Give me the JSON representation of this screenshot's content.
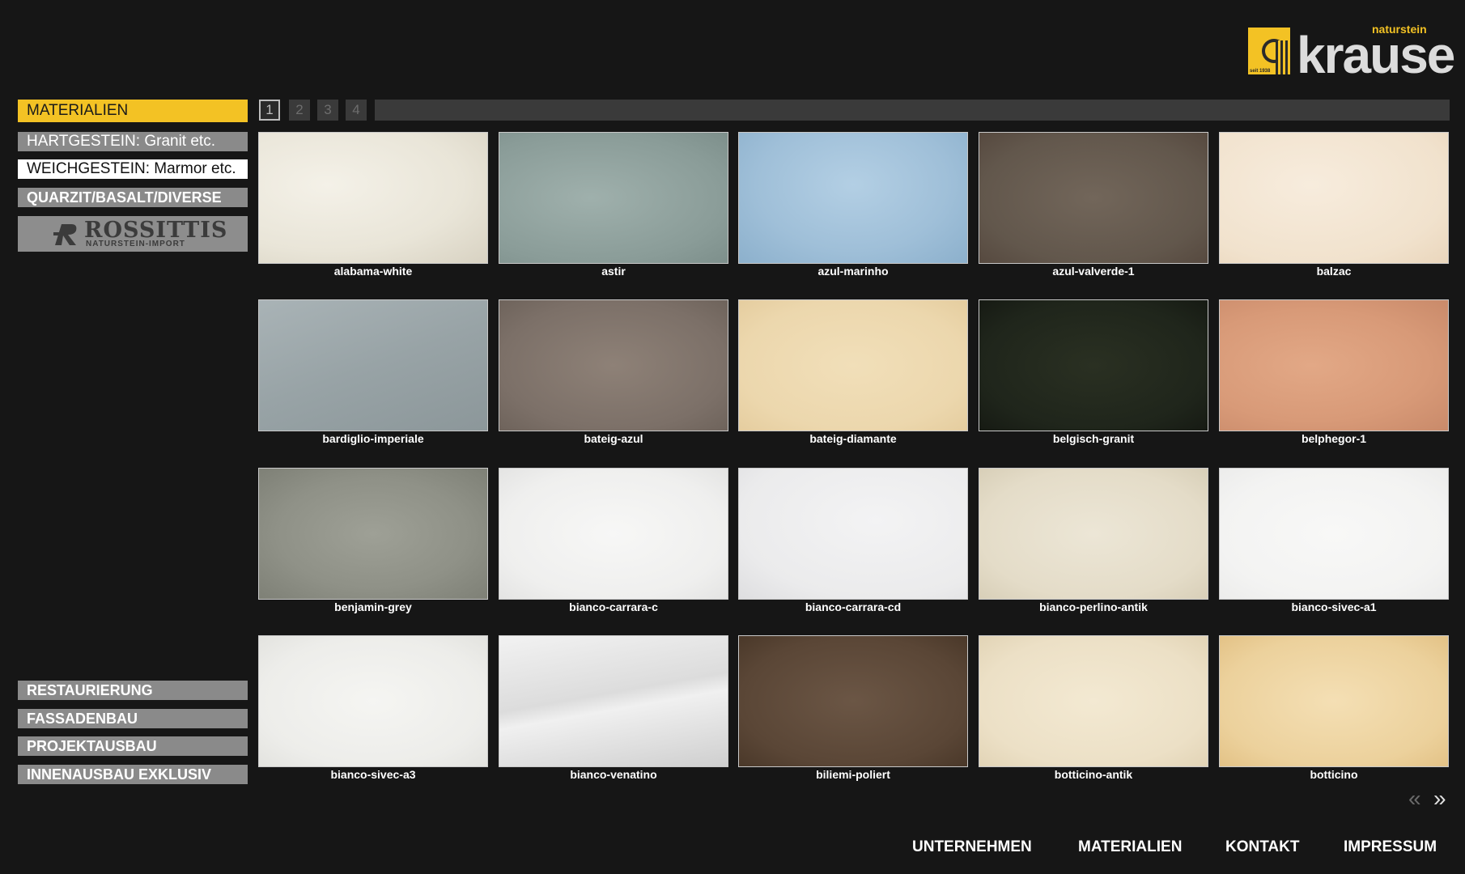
{
  "logo": {
    "brand": "krause",
    "tagline": "naturstein",
    "since": "seit 1938"
  },
  "sidebar": {
    "header": "MATERIALIEN",
    "items": [
      {
        "label": "HARTGESTEIN: Granit etc."
      },
      {
        "label": "WEICHGESTEIN: Marmor etc."
      },
      {
        "label": "QUARZIT/BASALT/DIVERSE"
      }
    ],
    "partner": {
      "name": "ROSSITTIS",
      "sub": "NATURSTEIN-IMPORT"
    },
    "bottom_items": [
      {
        "label": "RESTAURIERUNG"
      },
      {
        "label": "FASSADENBAU"
      },
      {
        "label": "PROJEKTAUSBAU"
      },
      {
        "label": "INNENAUSBAU EXKLUSIV"
      }
    ]
  },
  "pager": {
    "pages": [
      "1",
      "2",
      "3",
      "4"
    ],
    "current": "1"
  },
  "materials": [
    {
      "name": "alabama-white"
    },
    {
      "name": "astir"
    },
    {
      "name": "azul-marinho"
    },
    {
      "name": "azul-valverde-1"
    },
    {
      "name": "balzac"
    },
    {
      "name": "bardiglio-imperiale"
    },
    {
      "name": "bateig-azul"
    },
    {
      "name": "bateig-diamante"
    },
    {
      "name": "belgisch-granit"
    },
    {
      "name": "belphegor-1"
    },
    {
      "name": "benjamin-grey"
    },
    {
      "name": "bianco-carrara-c"
    },
    {
      "name": "bianco-carrara-cd"
    },
    {
      "name": "bianco-perlino-antik"
    },
    {
      "name": "bianco-sivec-a1"
    },
    {
      "name": "bianco-sivec-a3"
    },
    {
      "name": "bianco-venatino"
    },
    {
      "name": "biliemi-poliert"
    },
    {
      "name": "botticino-antik"
    },
    {
      "name": "botticino"
    }
  ],
  "arrows": {
    "prev": "«",
    "next": "»"
  },
  "footer": {
    "items": [
      {
        "label": "UNTERNEHMEN"
      },
      {
        "label": "MATERIALIEN"
      },
      {
        "label": "KONTAKT"
      },
      {
        "label": "IMPRESSUM"
      }
    ]
  },
  "colors": {
    "accent": "#f3c224",
    "background": "#161616",
    "button": "#8a8a8a"
  }
}
